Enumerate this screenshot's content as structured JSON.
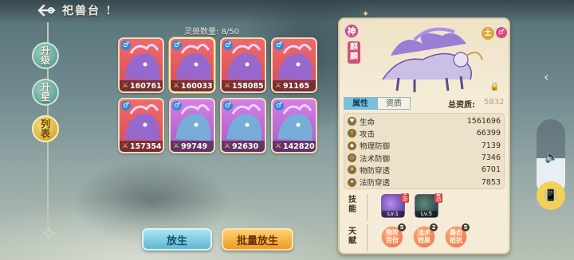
{
  "title": {
    "back_icon": "back-arrow-icon",
    "text": "祀兽台 !"
  },
  "menu": [
    {
      "label": "升级",
      "active": false
    },
    {
      "label": "升星",
      "active": false
    },
    {
      "label": "列表",
      "active": true
    }
  ],
  "pet_count": {
    "label": "灵兽数量: 8/50"
  },
  "pets": [
    {
      "power": "160761",
      "gender": "♂",
      "bg": "red",
      "selected": false
    },
    {
      "power": "160033",
      "gender": "♂",
      "bg": "red",
      "selected": true
    },
    {
      "power": "158085",
      "gender": "♂",
      "bg": "red",
      "selected": false
    },
    {
      "power": "91165",
      "gender": "♂",
      "bg": "red",
      "selected": false
    },
    {
      "power": "157354",
      "gender": "♂",
      "bg": "red",
      "selected": false
    },
    {
      "power": "99749",
      "gender": "♂",
      "bg": "purple",
      "selected": false
    },
    {
      "power": "92630",
      "gender": "♂",
      "bg": "purple",
      "selected": false
    },
    {
      "power": "142820",
      "gender": "♂",
      "bg": "purple",
      "selected": false
    }
  ],
  "buttons": {
    "release": "放生",
    "batch_release": "批量放生"
  },
  "detail": {
    "divine_badge": "神",
    "name": "麒麟",
    "element": "土",
    "gender": "♂",
    "tabs": [
      "属性",
      "资质"
    ],
    "total_label": "总资质:",
    "total_value": "5832",
    "stats": [
      {
        "label": "生命",
        "value": "1561696"
      },
      {
        "label": "攻击",
        "value": "66399"
      },
      {
        "label": "物理防御",
        "value": "7139"
      },
      {
        "label": "法术防御",
        "value": "7346"
      },
      {
        "label": "物防穿透",
        "value": "6701"
      },
      {
        "label": "法防穿透",
        "value": "7853"
      }
    ],
    "skills_label": "技能",
    "skills": [
      {
        "level": "Lv.1",
        "tag": "主动"
      },
      {
        "level": "Lv.5",
        "tag": "被动"
      }
    ],
    "talent_label": "天赋",
    "talents": [
      {
        "text": "物攻\n百倍",
        "count": "5"
      },
      {
        "text": "法术\n效果",
        "count": "2"
      },
      {
        "text": "暴击\n抵抗",
        "count": "5"
      }
    ]
  },
  "side": {
    "chevron": "‹",
    "volume_level": 0.5
  },
  "colors": {
    "accent_gold": "#f09b22",
    "accent_blue": "#5fb7d6",
    "panel_bg": "#f5ecd7"
  }
}
